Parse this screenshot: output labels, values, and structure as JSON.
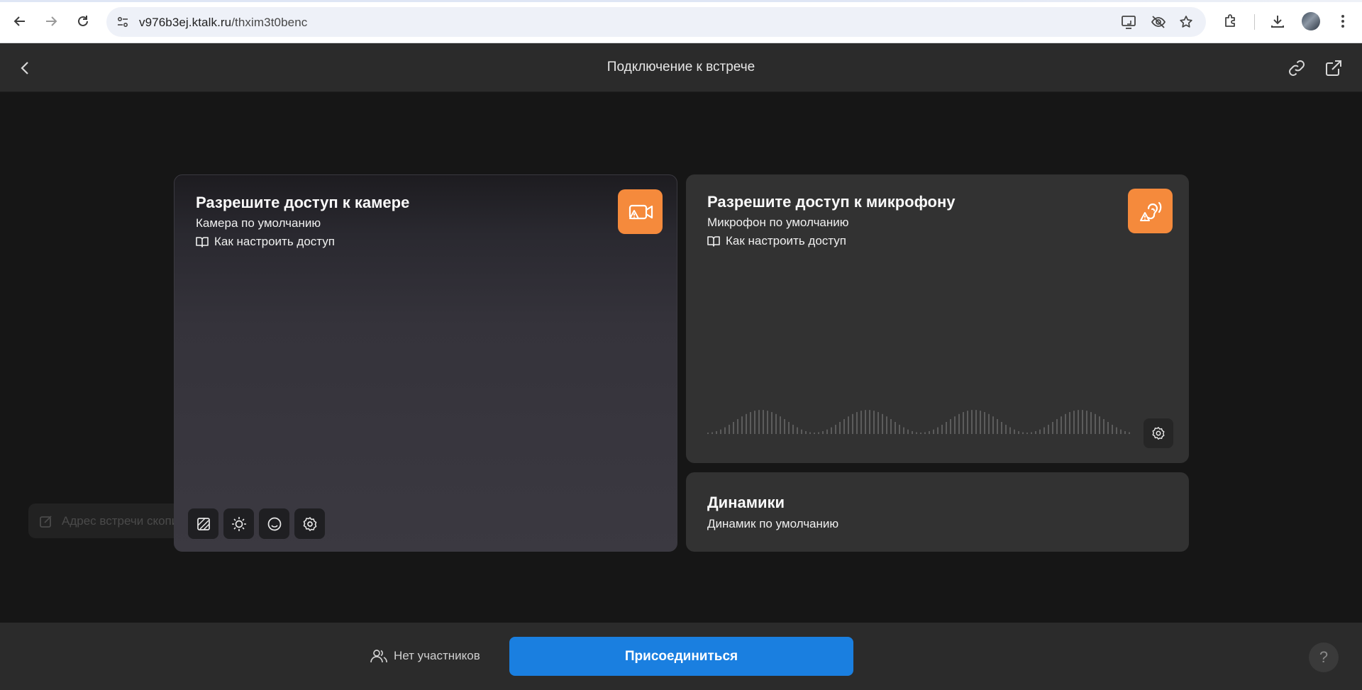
{
  "browser": {
    "url_host": "v976b3ej.ktalk.ru",
    "url_path": "/thxim3t0benc",
    "icons": [
      "back-icon",
      "forward-icon",
      "reload-icon",
      "site-info-icon",
      "cast-icon",
      "hide-icon",
      "star-icon",
      "extensions-icon",
      "download-icon",
      "avatar",
      "menu-icon"
    ]
  },
  "header": {
    "title": "Подключение к встрече"
  },
  "camera": {
    "title": "Разрешите доступ к камере",
    "device": "Камера по умолчанию",
    "help_link": "Как настроить доступ",
    "tools": [
      "background-blur-icon",
      "brightness-icon",
      "face-filter-icon",
      "settings-icon"
    ]
  },
  "microphone": {
    "title": "Разрешите доступ к микрофону",
    "device": "Микрофон по умолчанию",
    "help_link": "Как настроить доступ"
  },
  "speakers": {
    "title": "Динамики",
    "device": "Динамик по умолчанию"
  },
  "toast": {
    "text": "Адрес встречи скопир"
  },
  "footer": {
    "participants": "Нет участников",
    "join": "Присоединиться",
    "help": "?"
  },
  "colors": {
    "accent_orange": "#f58a3c",
    "join_blue": "#1a7fe0",
    "background": "#161616",
    "panel": "#323232"
  }
}
